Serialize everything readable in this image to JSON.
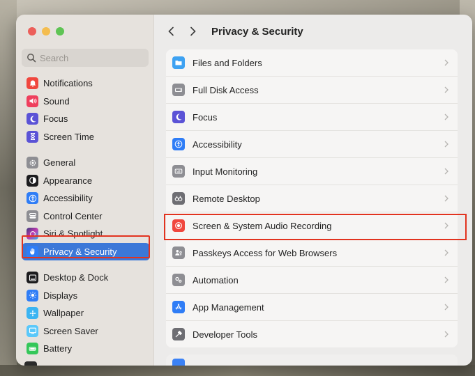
{
  "window": {
    "title": "Privacy & Security"
  },
  "search": {
    "placeholder": "Search",
    "value": ""
  },
  "sidebar": {
    "items": [
      {
        "label": "Notifications",
        "icon": "bell-icon",
        "color": "#f0473e"
      },
      {
        "label": "Sound",
        "icon": "speaker-icon",
        "color": "#ef3f5d"
      },
      {
        "label": "Focus",
        "icon": "moon-icon",
        "color": "#5b53d6"
      },
      {
        "label": "Screen Time",
        "icon": "hourglass-icon",
        "color": "#5b53d6"
      },
      {
        "label": "General",
        "icon": "gear-icon",
        "color": "#8e8e93"
      },
      {
        "label": "Appearance",
        "icon": "appearance-icon",
        "color": "#1c1c1e"
      },
      {
        "label": "Accessibility",
        "icon": "accessibility-icon",
        "color": "#2f7df6"
      },
      {
        "label": "Control Center",
        "icon": "control-center-icon",
        "color": "#8e8e93"
      },
      {
        "label": "Siri & Spotlight",
        "icon": "siri-icon",
        "color": "#6b46c1"
      },
      {
        "label": "Privacy & Security",
        "icon": "hand-icon",
        "color": "#2f7df6"
      },
      {
        "label": "Desktop & Dock",
        "icon": "dock-icon",
        "color": "#1c1c1e"
      },
      {
        "label": "Displays",
        "icon": "sun-icon",
        "color": "#2f7df6"
      },
      {
        "label": "Wallpaper",
        "icon": "wallpaper-icon",
        "color": "#3bb4f2"
      },
      {
        "label": "Screen Saver",
        "icon": "screen-saver-icon",
        "color": "#5ac8fa"
      },
      {
        "label": "Battery",
        "icon": "battery-icon",
        "color": "#34c759"
      }
    ]
  },
  "main": {
    "rows": [
      {
        "label": "Files and Folders",
        "icon": "folder-icon",
        "color": "#3ea2f2"
      },
      {
        "label": "Full Disk Access",
        "icon": "disk-icon",
        "color": "#8e8e93"
      },
      {
        "label": "Focus",
        "icon": "moon-icon",
        "color": "#5b53d6"
      },
      {
        "label": "Accessibility",
        "icon": "accessibility-icon",
        "color": "#2f7df6"
      },
      {
        "label": "Input Monitoring",
        "icon": "keyboard-icon",
        "color": "#8e8e93"
      },
      {
        "label": "Remote Desktop",
        "icon": "binoculars-icon",
        "color": "#6e6e73"
      },
      {
        "label": "Screen & System Audio Recording",
        "icon": "record-icon",
        "color": "#f0473e"
      },
      {
        "label": "Passkeys Access for Web Browsers",
        "icon": "passkey-icon",
        "color": "#8e8e93"
      },
      {
        "label": "Automation",
        "icon": "automation-icon",
        "color": "#8e8e93"
      },
      {
        "label": "App Management",
        "icon": "app-store-icon",
        "color": "#2f7df6"
      },
      {
        "label": "Developer Tools",
        "icon": "hammer-icon",
        "color": "#6e6e73"
      }
    ]
  },
  "highlight_color": "#e2331f",
  "accent_color": "#3c78d8"
}
